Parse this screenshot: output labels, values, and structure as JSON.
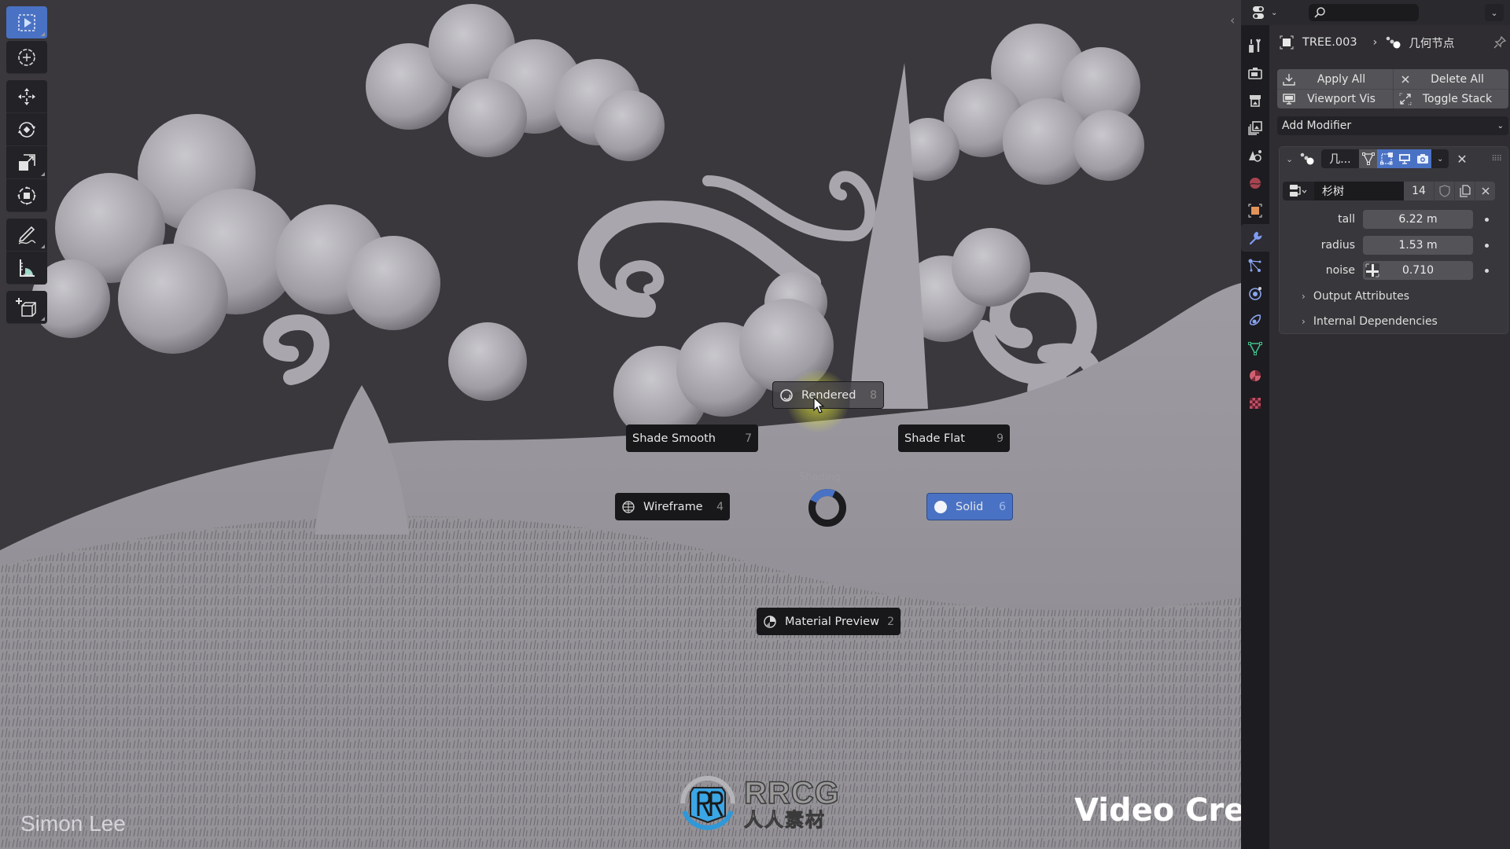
{
  "viewport": {
    "background": "#3a383c",
    "toolbar": [
      {
        "name": "select-box-tool",
        "icon": "select-box-icon",
        "active": true
      },
      {
        "name": "cursor-tool",
        "icon": "cursor-icon",
        "active": false
      },
      {
        "name": "move-tool",
        "icon": "move-icon",
        "active": false
      },
      {
        "name": "rotate-tool",
        "icon": "rotate-icon",
        "active": false
      },
      {
        "name": "scale-tool",
        "icon": "scale-icon",
        "active": false
      },
      {
        "name": "transform-tool",
        "icon": "transform-icon",
        "active": false
      },
      {
        "name": "annotate-tool",
        "icon": "annotate-icon",
        "active": false
      },
      {
        "name": "measure-tool",
        "icon": "measure-icon",
        "active": false
      },
      {
        "name": "add-cube-tool",
        "icon": "add-cube-icon",
        "active": false
      }
    ],
    "pie_menu": {
      "title": "Shading",
      "items": [
        {
          "label": "Rendered",
          "shortcut": "8",
          "icon": "rendered-icon",
          "state": "hover"
        },
        {
          "label": "Shade Smooth",
          "shortcut": "7",
          "icon": "",
          "state": "normal"
        },
        {
          "label": "Shade Flat",
          "shortcut": "9",
          "icon": "",
          "state": "normal"
        },
        {
          "label": "Wireframe",
          "shortcut": "4",
          "icon": "wireframe-icon",
          "state": "normal"
        },
        {
          "label": "Solid",
          "shortcut": "6",
          "icon": "solid-icon",
          "state": "selected"
        },
        {
          "label": "Material Preview",
          "shortcut": "2",
          "icon": "material-preview-icon",
          "state": "normal"
        }
      ]
    },
    "watermarks": {
      "author": "Simon Lee",
      "logo_text": "RRCG",
      "logo_subtext": "人人素材",
      "credit": "Video Credit: Blender"
    }
  },
  "properties": {
    "tabs": [
      {
        "name": "tool",
        "color": "#c8c8c8"
      },
      {
        "name": "render",
        "color": "#c8c8c8"
      },
      {
        "name": "output",
        "color": "#c8c8c8"
      },
      {
        "name": "view-layer",
        "color": "#c8c8c8"
      },
      {
        "name": "scene",
        "color": "#c8c8c8"
      },
      {
        "name": "world",
        "color": "#c0505a"
      },
      {
        "name": "object",
        "color": "#e0945a"
      },
      {
        "name": "modifiers",
        "color": "#7e9cf0",
        "active": true
      },
      {
        "name": "particles",
        "color": "#7e9cf0"
      },
      {
        "name": "physics",
        "color": "#7e9cf0"
      },
      {
        "name": "constraints",
        "color": "#7e9cf0"
      },
      {
        "name": "data",
        "color": "#3fc08a"
      },
      {
        "name": "material",
        "color": "#d06070"
      },
      {
        "name": "texture",
        "color": "#c05068"
      }
    ],
    "search": {
      "placeholder": ""
    },
    "breadcrumb": {
      "object": "TREE.003",
      "modifier": "几何节点"
    },
    "buttons": {
      "apply_all": "Apply All",
      "delete_all": "Delete All",
      "viewport_vis": "Viewport Vis",
      "toggle_stack": "Toggle Stack"
    },
    "add_modifier": "Add Modifier",
    "modifier": {
      "name": "几...",
      "toggles": {
        "edit_cage": false,
        "edit_mode": true,
        "viewport": true,
        "render": true
      },
      "node_group": {
        "name": "杉树",
        "users": "14"
      },
      "inputs": [
        {
          "label": "tall",
          "value": "6.22 m"
        },
        {
          "label": "radius",
          "value": "1.53 m"
        },
        {
          "label": "noise",
          "value": "0.710",
          "texture_icon": true
        }
      ],
      "subpanels": [
        "Output Attributes",
        "Internal Dependencies"
      ]
    }
  },
  "colors": {
    "accent": "#4a72c4",
    "panel_bg": "#2f2d31",
    "tab_strip_bg": "#1d1c20",
    "field_bg": "#545357",
    "menu_bg": "#18171a"
  }
}
